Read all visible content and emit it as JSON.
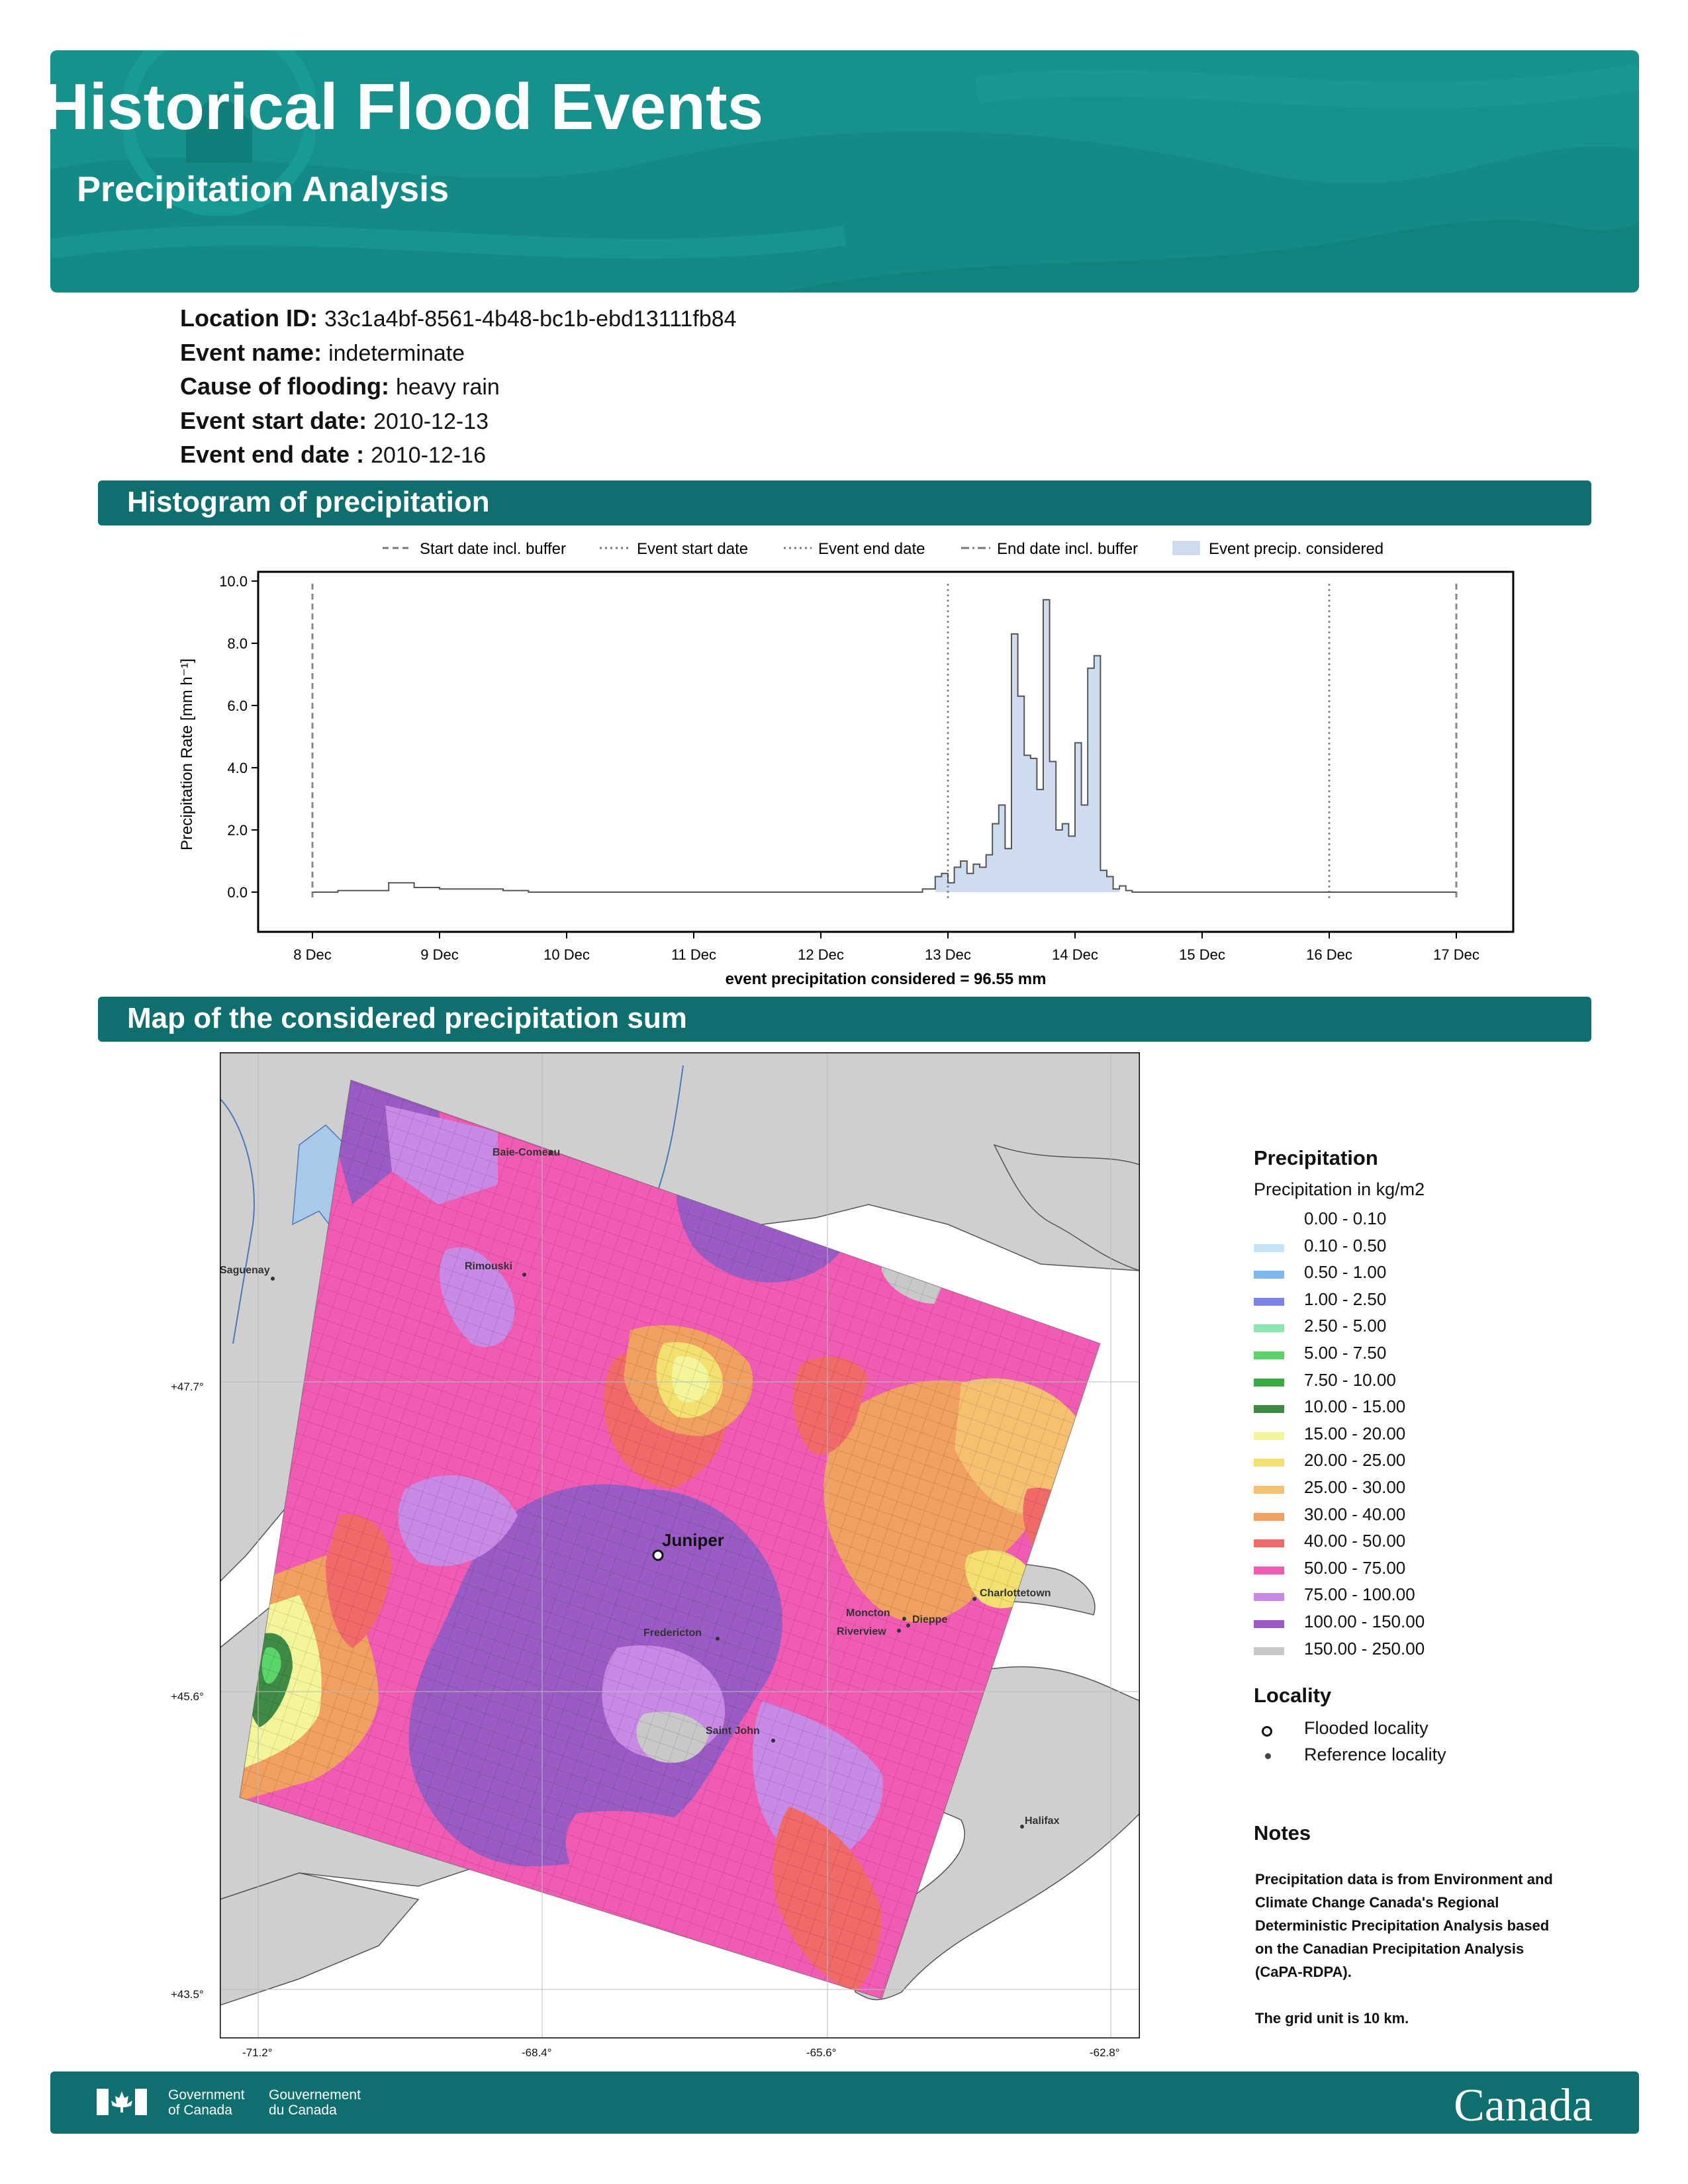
{
  "header": {
    "title": "Historical Flood Events",
    "subtitle": "Precipitation Analysis"
  },
  "info": [
    {
      "label": "Location ID:",
      "value": "33c1a4bf-8561-4b48-bc1b-ebd13111fb84"
    },
    {
      "label": "Event name:",
      "value": "indeterminate"
    },
    {
      "label": "Cause of flooding:",
      "value": "heavy rain"
    },
    {
      "label": "Event start date:",
      "value": "2010-12-13"
    },
    {
      "label": "Event end date :",
      "value": "2010-12-16"
    }
  ],
  "sections": {
    "histogram": "Histogram of precipitation",
    "map": "Map of the considered precipitation sum"
  },
  "chart_data": {
    "type": "area",
    "ylabel": "Precipitation Rate [mm h⁻¹]",
    "xlabel": "event precipitation considered = 96.55 mm",
    "ylim": [
      0,
      10
    ],
    "yticks": [
      "0.0",
      "2.0",
      "4.0",
      "6.0",
      "8.0",
      "10.0"
    ],
    "xlim_days": [
      7.6,
      17.3
    ],
    "xticks": [
      "8 Dec",
      "9 Dec",
      "10 Dec",
      "11 Dec",
      "12 Dec",
      "13 Dec",
      "14 Dec",
      "15 Dec",
      "16 Dec",
      "17 Dec"
    ],
    "legend": [
      {
        "label": "Start date incl. buffer",
        "style": "dashed"
      },
      {
        "label": "Event start date",
        "style": "dotted"
      },
      {
        "label": "Event end date",
        "style": "dotted"
      },
      {
        "label": "End date incl. buffer",
        "style": "dashdot"
      },
      {
        "label": "Event precip. considered",
        "style": "patch"
      }
    ],
    "vlines": [
      {
        "day": 8,
        "style": "dashed"
      },
      {
        "day": 13,
        "style": "dotted"
      },
      {
        "day": 16,
        "style": "dotted"
      },
      {
        "day": 17,
        "style": "dashed"
      }
    ],
    "shaded_range": [
      12.9,
      14.35
    ],
    "series": [
      {
        "x": [
          8.0,
          8.2,
          8.4,
          8.6,
          8.8,
          9.0,
          9.2,
          9.4,
          9.5,
          9.7,
          12.8,
          12.9,
          12.95,
          13.0,
          13.05,
          13.1,
          13.15,
          13.2,
          13.25,
          13.3,
          13.35,
          13.4,
          13.45,
          13.5,
          13.55,
          13.6,
          13.65,
          13.7,
          13.75,
          13.8,
          13.85,
          13.9,
          13.95,
          14.0,
          14.05,
          14.1,
          14.15,
          14.2,
          14.25,
          14.3,
          14.35,
          14.4,
          14.45,
          14.5,
          14.6,
          15.0,
          16.0,
          17.0
        ],
        "y": [
          0.0,
          0.05,
          0.05,
          0.3,
          0.15,
          0.1,
          0.1,
          0.1,
          0.05,
          0.0,
          0.1,
          0.5,
          0.6,
          0.3,
          0.8,
          1.0,
          0.6,
          0.9,
          0.8,
          1.2,
          2.2,
          2.8,
          1.4,
          8.3,
          6.3,
          4.4,
          4.3,
          3.3,
          9.4,
          4.2,
          2.0,
          2.2,
          1.8,
          4.8,
          2.8,
          7.2,
          7.6,
          0.7,
          0.5,
          0.1,
          0.2,
          0.05,
          0.0,
          0.0,
          0.0,
          0.0,
          0.0,
          0.0
        ]
      }
    ]
  },
  "map": {
    "lat_labels": [
      "+47.7°",
      "+45.6°",
      "+43.5°"
    ],
    "lon_labels": [
      "-71.2°",
      "-68.4°",
      "-65.6°",
      "-62.8°"
    ],
    "places": [
      "Baie-Comeau",
      "Rimouski",
      "Saguenay",
      "Juniper",
      "Fredericton",
      "Moncton",
      "Dieppe",
      "Riverview",
      "Saint John",
      "Charlottetown",
      "Halifax"
    ]
  },
  "legend": {
    "title": "Precipitation",
    "subtitle": "Precipitation in kg/m2",
    "bins": [
      {
        "label": "0.00 - 0.10",
        "color": "#ffffff"
      },
      {
        "label": "0.10 - 0.50",
        "color": "#c6e4f7"
      },
      {
        "label": "0.50 - 1.00",
        "color": "#7fb8f0"
      },
      {
        "label": "1.00 - 2.50",
        "color": "#7b83e8"
      },
      {
        "label": "2.50 - 5.00",
        "color": "#8ce8b0"
      },
      {
        "label": "5.00 - 7.50",
        "color": "#5bd46a"
      },
      {
        "label": "7.50 - 10.00",
        "color": "#3aaa45"
      },
      {
        "label": "10.00 - 15.00",
        "color": "#3f8a45"
      },
      {
        "label": "15.00 - 20.00",
        "color": "#f3f59a"
      },
      {
        "label": "20.00 - 25.00",
        "color": "#f3e070"
      },
      {
        "label": "25.00 - 30.00",
        "color": "#f5c170"
      },
      {
        "label": "30.00 - 40.00",
        "color": "#f0a060"
      },
      {
        "label": "40.00 - 50.00",
        "color": "#f06a6a"
      },
      {
        "label": "50.00 - 75.00",
        "color": "#f05cb4"
      },
      {
        "label": "75.00 - 100.00",
        "color": "#c98ae6"
      },
      {
        "label": "100.00 - 150.00",
        "color": "#9a5cc4"
      },
      {
        "label": "150.00 - 250.00",
        "color": "#c8c8c8"
      }
    ],
    "locality_title": "Locality",
    "flooded": "Flooded locality",
    "reference": "Reference locality"
  },
  "notes": {
    "title": "Notes",
    "lines": [
      "Precipitation data is from Environment and",
      "Climate Change Canada's Regional",
      "Deterministic Precipitation Analysis based",
      "on the Canadian Precipitation Analysis",
      "(CaPA-RDPA).",
      "",
      "The grid unit is 10 km."
    ]
  },
  "footer": {
    "gov_en_1": "Government",
    "gov_en_2": "of Canada",
    "gov_fr_1": "Gouvernement",
    "gov_fr_2": "du Canada",
    "wordmark": "Canada"
  }
}
